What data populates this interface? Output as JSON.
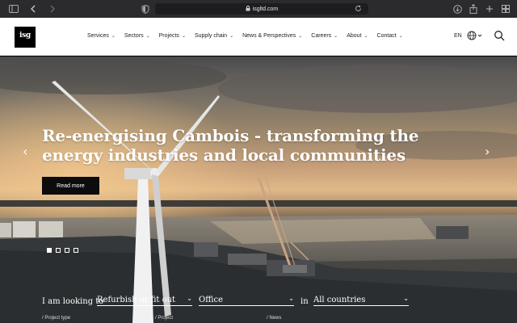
{
  "browser": {
    "url": "isgltd.com",
    "icons": {
      "sidebar": "sidebar-icon",
      "back": "chevron-left-icon",
      "forward": "chevron-right-icon",
      "shield": "shield-icon",
      "lock": "lock-icon",
      "reload": "reload-icon",
      "download": "download-icon",
      "share": "share-icon",
      "new_tab": "plus-icon",
      "tabs": "tab-overview-icon"
    }
  },
  "header": {
    "logo_text": "isg",
    "nav": [
      {
        "label": "Services"
      },
      {
        "label": "Sectors"
      },
      {
        "label": "Projects"
      },
      {
        "label": "Supply chain"
      },
      {
        "label": "News & Perspectives"
      },
      {
        "label": "Careers"
      },
      {
        "label": "About"
      },
      {
        "label": "Contact"
      }
    ],
    "language": "EN",
    "icons": {
      "globe": "globe-icon",
      "search": "search-icon"
    }
  },
  "hero": {
    "headline": "Re-energising Cambois - transforming the energy industries and local communities",
    "cta_label": "Read more",
    "slides": 4,
    "active_slide": 1
  },
  "finder": {
    "prefix": "I am looking to",
    "in_label": "in",
    "project_type": "Refurbish or fit out",
    "project": "Office",
    "region": "All countries",
    "sub_labels": [
      "Project type",
      "Project",
      "News"
    ]
  },
  "colors": {
    "header_bg": "#ffffff",
    "button_bg": "#0c0c0c",
    "chrome_bg": "#2b2b2d"
  }
}
